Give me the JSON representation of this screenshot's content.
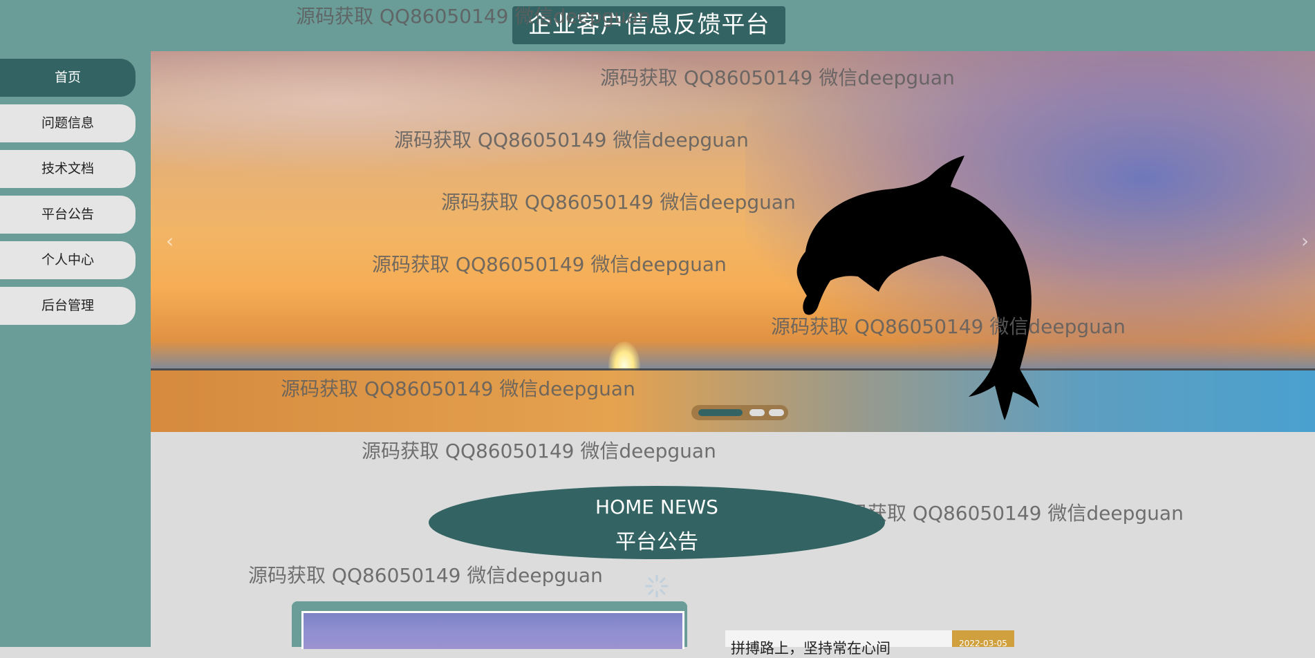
{
  "header": {
    "title": "企业客户信息反馈平台"
  },
  "sidebar": {
    "items": [
      {
        "label": "首页",
        "active": true
      },
      {
        "label": "问题信息",
        "active": false
      },
      {
        "label": "技术文档",
        "active": false
      },
      {
        "label": "平台公告",
        "active": false
      },
      {
        "label": "个人中心",
        "active": false
      },
      {
        "label": "后台管理",
        "active": false
      }
    ]
  },
  "banner": {
    "prev_icon": "‹",
    "next_icon": "›",
    "slide_count": 3,
    "active_slide": 1
  },
  "watermark_text": "源码获取 QQ86050149 微信deepguan",
  "news_section": {
    "heading_en": "HOME NEWS",
    "heading_cn": "平台公告",
    "items": [
      {
        "title": "拼搏路上，坚持常在心间",
        "date": "2022-03-05"
      }
    ]
  },
  "colors": {
    "primary": "#336463",
    "sidebar_bg": "#6a9c98",
    "page_bg": "#dcdcdc",
    "date_badge": "#d1a03e"
  }
}
